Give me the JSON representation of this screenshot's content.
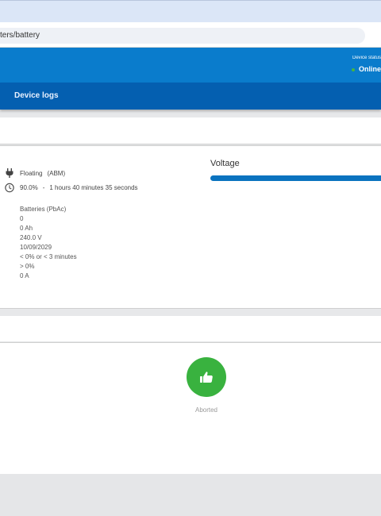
{
  "browser": {
    "url": "ters/battery"
  },
  "header": {
    "device_status_label": "Device status",
    "online_label": "Online"
  },
  "nav": {
    "device_logs": "Device logs"
  },
  "battery": {
    "state": "Floating",
    "type": "(ABM)",
    "charge": "90.0%",
    "separator": "-",
    "time_remaining": "1 hours 40 minutes 35 seconds",
    "details": [
      "Batteries (PbAc)",
      "0",
      "0 Ah",
      "240.0 V",
      "10/09/2029",
      "< 0% or < 3 minutes",
      "> 0%",
      "0 A"
    ]
  },
  "voltage": {
    "title": "Voltage"
  },
  "test": {
    "status": "Aborted"
  },
  "colors": {
    "banner": "#0a7ccc",
    "navbar": "#045fb0",
    "success": "#39b23f",
    "online_dot": "#47b540"
  }
}
